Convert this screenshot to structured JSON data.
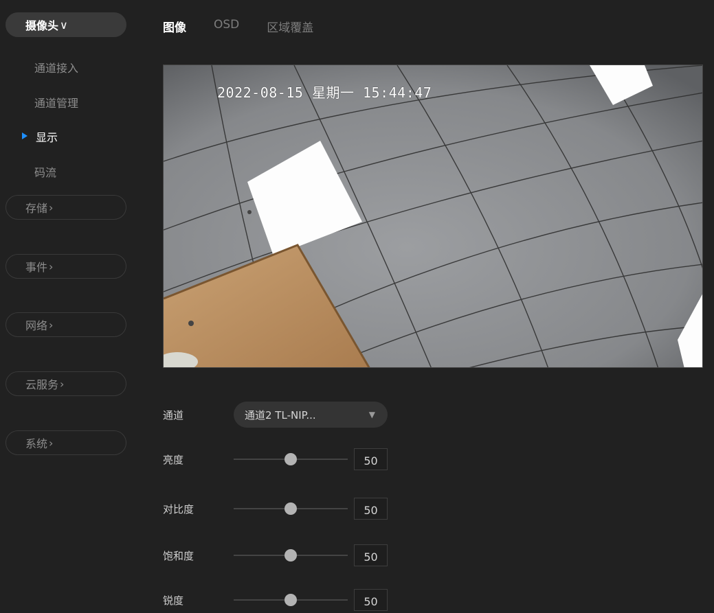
{
  "sidebar": {
    "camera_group": {
      "label": "摄像头",
      "chevron": "∨"
    },
    "camera_items": [
      {
        "label": "通道接入",
        "current": false
      },
      {
        "label": "通道管理",
        "current": false
      },
      {
        "label": "显示",
        "current": true
      },
      {
        "label": "码流",
        "current": false
      }
    ],
    "groups": [
      {
        "label": "存储",
        "chevron": "›"
      },
      {
        "label": "事件",
        "chevron": "›"
      },
      {
        "label": "网络",
        "chevron": "›"
      },
      {
        "label": "云服务",
        "chevron": "›"
      },
      {
        "label": "系统",
        "chevron": "›"
      }
    ],
    "current_indicator_color": "#1e90ff"
  },
  "tabs": [
    {
      "label": "图像",
      "active": true
    },
    {
      "label": "OSD",
      "active": false
    },
    {
      "label": "区域覆盖",
      "active": false
    }
  ],
  "preview": {
    "osd_timestamp": "2022-08-15 星期一 15:44:47",
    "scene": "fisheye ceiling tiles camera view"
  },
  "settings": {
    "channel": {
      "label": "通道",
      "value": "通道2 TL-NIP...",
      "caret_icon": "triangle-down-icon"
    },
    "sliders": [
      {
        "key": "brightness",
        "label": "亮度",
        "value": "50",
        "fraction": 0.5
      },
      {
        "key": "contrast",
        "label": "对比度",
        "value": "50",
        "fraction": 0.5
      },
      {
        "key": "saturation",
        "label": "饱和度",
        "value": "50",
        "fraction": 0.5
      },
      {
        "key": "sharpness",
        "label": "锐度",
        "value": "50",
        "fraction": 0.5
      }
    ]
  }
}
